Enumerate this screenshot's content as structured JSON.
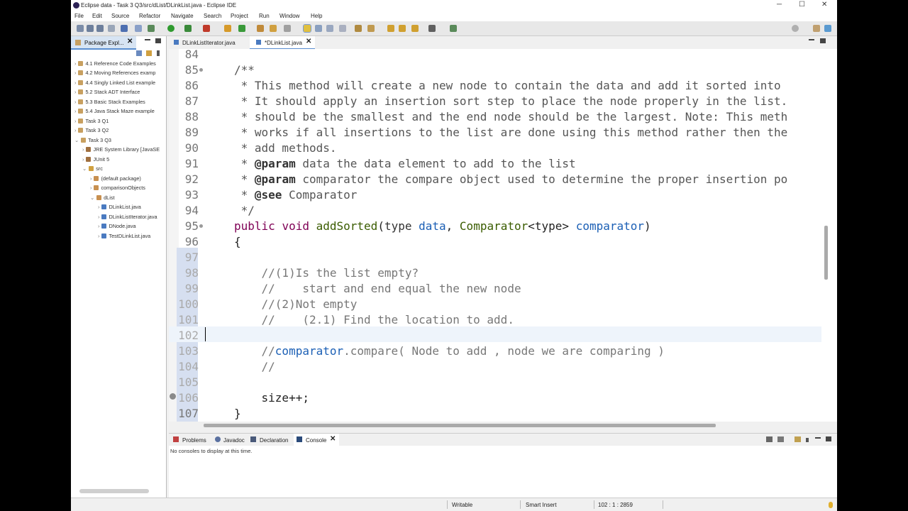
{
  "window": {
    "title": "Eclipse data - Task 3 Q3/src/dList/DLinkList.java - Eclipse IDE",
    "minimize": "─",
    "maximize": "☐",
    "close": "✕"
  },
  "menu": [
    "File",
    "Edit",
    "Source",
    "Refactor",
    "Navigate",
    "Search",
    "Project",
    "Run",
    "Window",
    "Help"
  ],
  "package_explorer": {
    "tab_label": "Package Expl...",
    "close": "✕",
    "items": [
      {
        "label": "4.1 Reference Code Examples",
        "arrow": "›"
      },
      {
        "label": "4.2 Moving References examp",
        "arrow": "›"
      },
      {
        "label": "4.4 Singly Linked List example",
        "arrow": "›"
      },
      {
        "label": "5.2 Stack ADT Interface",
        "arrow": "›"
      },
      {
        "label": "5.3 Basic Stack Examples",
        "arrow": "›"
      },
      {
        "label": "5.4 Java Stack Maze example",
        "arrow": "›"
      },
      {
        "label": "Task 3 Q1",
        "arrow": "›"
      },
      {
        "label": "Task 3 Q2",
        "arrow": "›"
      },
      {
        "label": "Task 3 Q3",
        "arrow": "⌄"
      },
      {
        "label": "JRE System Library [JavaSE",
        "arrow": "›"
      },
      {
        "label": "JUnit 5",
        "arrow": "›"
      },
      {
        "label": "src",
        "arrow": "⌄"
      },
      {
        "label": "(default package)",
        "arrow": "›"
      },
      {
        "label": "comparisonObjects",
        "arrow": "›"
      },
      {
        "label": "dList",
        "arrow": "⌄"
      },
      {
        "label": "DLinkList.java",
        "arrow": "›"
      },
      {
        "label": "DLinkListIterator.java",
        "arrow": "›"
      },
      {
        "label": "DNode.java",
        "arrow": "›"
      },
      {
        "label": "TestDLinkList.java",
        "arrow": "›"
      }
    ]
  },
  "editor_tabs": [
    {
      "label": "DLinkListIterator.java",
      "active": false
    },
    {
      "label": "*DLinkList.java",
      "active": true,
      "close": "✕"
    }
  ],
  "code_lines": [
    {
      "n": "84",
      "text": ""
    },
    {
      "n": "85",
      "text": "/**"
    },
    {
      "n": "86",
      "text": " * This method will create a new node to contain the data and add it sorted into"
    },
    {
      "n": "87",
      "text": " * It should apply an insertion sort step to place the node properly in the list."
    },
    {
      "n": "88",
      "text": " * should be the smallest and the end node should be the largest. Note: This meth"
    },
    {
      "n": "89",
      "text": " * works if all insertions to the list are done using this method rather then the"
    },
    {
      "n": "90",
      "text": " * add methods."
    },
    {
      "n": "91",
      "tag": "@param",
      "text": " data the data element to add to the list"
    },
    {
      "n": "92",
      "tag": "@param",
      "text": " comparator the compare object used to determine the proper insertion po"
    },
    {
      "n": "93",
      "tag": "@see",
      "text": " Comparator"
    },
    {
      "n": "94",
      "text": " */"
    },
    {
      "n": "95",
      "sig": {
        "kw1": "public",
        "kw2": "void",
        "name": "addSorted",
        "open": "(",
        "t1": "type",
        "p1": "data",
        "comma": ", ",
        "t2": "Comparator",
        "gen": "<type>",
        "p2": "comparator",
        "close": ")"
      }
    },
    {
      "n": "96",
      "text": "{"
    },
    {
      "n": "97",
      "text": ""
    },
    {
      "n": "98",
      "text": "    //(1)Is the list empty?"
    },
    {
      "n": "99",
      "text": "    //    start and end equal the new node"
    },
    {
      "n": "100",
      "text": "    //(2)Not empty"
    },
    {
      "n": "101",
      "text": "    //    (2.1) Find the location to add."
    },
    {
      "n": "102",
      "text": ""
    },
    {
      "n": "103",
      "pre": "    //",
      "ref": "comparator",
      "rest": ".compare( Node to add , node we are comparing )"
    },
    {
      "n": "104",
      "text": "    //"
    },
    {
      "n": "105",
      "text": ""
    },
    {
      "n": "106",
      "text": "    size++;"
    },
    {
      "n": "107",
      "text": "}"
    }
  ],
  "bottom_tabs": [
    {
      "label": "Problems",
      "active": false
    },
    {
      "label": "Javadoc",
      "active": false
    },
    {
      "label": "Declaration",
      "active": false
    },
    {
      "label": "Console",
      "active": true,
      "close": "✕"
    }
  ],
  "console": {
    "message": "No consoles to display at this time."
  },
  "status": {
    "mode": "Writable",
    "insert": "Smart Insert",
    "position": "102 : 1 : 2859"
  }
}
